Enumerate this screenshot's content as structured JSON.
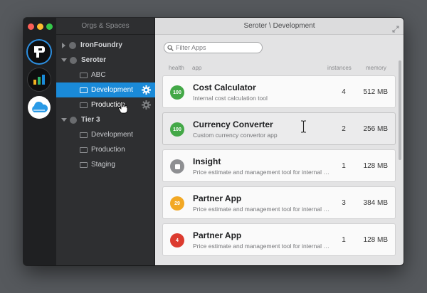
{
  "window": {
    "controls": [
      "close",
      "minimize",
      "zoom"
    ]
  },
  "rail": {
    "items": [
      {
        "name": "pivotal-logo-icon",
        "selected": true
      },
      {
        "name": "metrics-bars-icon",
        "selected": false
      },
      {
        "name": "cloud-icon",
        "selected": false
      }
    ]
  },
  "orgs": {
    "title": "Orgs & Spaces",
    "tree": [
      {
        "type": "org",
        "label": "IronFoundry",
        "expanded": false
      },
      {
        "type": "org",
        "label": "Seroter",
        "expanded": true
      },
      {
        "type": "space",
        "label": "ABC"
      },
      {
        "type": "space",
        "label": "Development",
        "selected": true
      },
      {
        "type": "space",
        "label": "Production"
      },
      {
        "type": "org",
        "label": "Tier 3",
        "expanded": true
      },
      {
        "type": "space",
        "label": "Development"
      },
      {
        "type": "space",
        "label": "Production"
      },
      {
        "type": "space",
        "label": "Staging"
      }
    ]
  },
  "main": {
    "title": "Seroter \\ Development",
    "filter_placeholder": "Filter Apps",
    "columns": {
      "health": "health",
      "app": "app",
      "instances": "instances",
      "memory": "memory"
    },
    "apps": [
      {
        "health": "100",
        "status": "running",
        "color": "#43a847",
        "name": "Cost Calculator",
        "desc": "Internal cost calculation tool",
        "instances": "4",
        "memory": "512 MB"
      },
      {
        "health": "100",
        "status": "running",
        "color": "#43a847",
        "name": "Currency Converter",
        "desc": "Custom currency convertor app",
        "instances": "2",
        "memory": "256 MB"
      },
      {
        "health": "",
        "status": "stopped",
        "color": "#8e8f92",
        "name": "Insight",
        "desc": "Price estimate and management tool for internal use",
        "instances": "1",
        "memory": "128 MB"
      },
      {
        "health": "29",
        "status": "warning",
        "color": "#f2a824",
        "name": "Partner App",
        "desc": "Price estimate and management tool for internal use",
        "instances": "3",
        "memory": "384 MB"
      },
      {
        "health": "4",
        "status": "critical",
        "color": "#dc3b2f",
        "name": "Partner App",
        "desc": "Price estimate and management tool for internal use",
        "instances": "1",
        "memory": "128 MB"
      }
    ]
  },
  "colors": {
    "selection": "#1a8ad8",
    "accent_orange": "#f5a623"
  }
}
